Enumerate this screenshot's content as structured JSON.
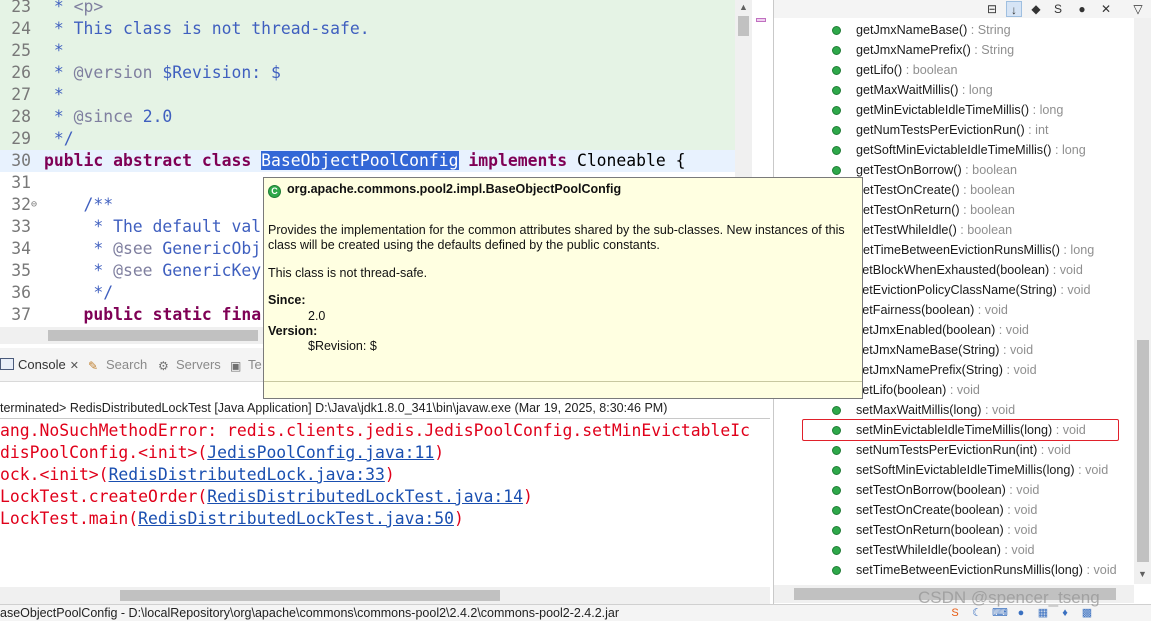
{
  "editor": {
    "lines": [
      {
        "num": "23",
        "tokens": [
          {
            "cls": "c-com",
            "text": " * "
          },
          {
            "cls": "c-tag",
            "text": "<p>"
          }
        ],
        "bg": "comment-bg"
      },
      {
        "num": "24",
        "tokens": [
          {
            "cls": "c-com",
            "text": " * This class is not thread-safe."
          }
        ],
        "bg": "comment-bg"
      },
      {
        "num": "25",
        "tokens": [
          {
            "cls": "c-com",
            "text": " *"
          }
        ],
        "bg": "comment-bg"
      },
      {
        "num": "26",
        "tokens": [
          {
            "cls": "c-com",
            "text": " * "
          },
          {
            "cls": "c-tag",
            "text": "@version"
          },
          {
            "cls": "c-com",
            "text": " $Revision: $"
          }
        ],
        "bg": "comment-bg"
      },
      {
        "num": "27",
        "tokens": [
          {
            "cls": "c-com",
            "text": " *"
          }
        ],
        "bg": "comment-bg"
      },
      {
        "num": "28",
        "tokens": [
          {
            "cls": "c-com",
            "text": " * "
          },
          {
            "cls": "c-tag",
            "text": "@since"
          },
          {
            "cls": "c-com",
            "text": " 2.0"
          }
        ],
        "bg": "comment-bg"
      },
      {
        "num": "29",
        "tokens": [
          {
            "cls": "c-com",
            "text": " */"
          }
        ],
        "bg": "comment-bg"
      },
      {
        "num": "30",
        "tokens": [
          {
            "cls": "c-kw",
            "text": "public"
          },
          {
            "cls": "",
            "text": " "
          },
          {
            "cls": "c-kw",
            "text": "abstract"
          },
          {
            "cls": "",
            "text": " "
          },
          {
            "cls": "c-kw",
            "text": "class"
          },
          {
            "cls": "",
            "text": " "
          },
          {
            "cls": "c-sel",
            "text": "BaseObjectPoolConfig"
          },
          {
            "cls": "",
            "text": " "
          },
          {
            "cls": "c-kw",
            "text": "implements"
          },
          {
            "cls": "",
            "text": " Cloneable {"
          }
        ],
        "bg": "current"
      },
      {
        "num": "31",
        "tokens": [],
        "bg": ""
      },
      {
        "num": "32",
        "fold": "⊖",
        "tokens": [
          {
            "cls": "c-com",
            "text": "    /**"
          }
        ],
        "bg": ""
      },
      {
        "num": "33",
        "tokens": [
          {
            "cls": "c-com",
            "text": "     * The default val"
          }
        ],
        "bg": ""
      },
      {
        "num": "34",
        "tokens": [
          {
            "cls": "c-com",
            "text": "     * "
          },
          {
            "cls": "c-tag",
            "text": "@see"
          },
          {
            "cls": "c-com",
            "text": " GenericObj"
          }
        ],
        "bg": ""
      },
      {
        "num": "35",
        "tokens": [
          {
            "cls": "c-com",
            "text": "     * "
          },
          {
            "cls": "c-tag",
            "text": "@see"
          },
          {
            "cls": "c-com",
            "text": " GenericKey"
          }
        ],
        "bg": ""
      },
      {
        "num": "36",
        "tokens": [
          {
            "cls": "c-com",
            "text": "     */"
          }
        ],
        "bg": ""
      },
      {
        "num": "37",
        "tokens": [
          {
            "cls": "",
            "text": "    "
          },
          {
            "cls": "c-kw",
            "text": "public"
          },
          {
            "cls": "",
            "text": " "
          },
          {
            "cls": "c-kw",
            "text": "static"
          },
          {
            "cls": "",
            "text": " "
          },
          {
            "cls": "c-kw",
            "text": "fina"
          }
        ],
        "bg": ""
      }
    ]
  },
  "console": {
    "tabs": [
      {
        "label": "Console",
        "icon": "console-icon",
        "active": true
      },
      {
        "label": "Search",
        "icon": "search-icon",
        "active": false
      },
      {
        "label": "Servers",
        "icon": "servers-icon",
        "active": false
      },
      {
        "label": "Te",
        "icon": "terminal-icon",
        "active": false
      }
    ],
    "status": "terminated> RedisDistributedLockTest [Java Application] D:\\Java\\jdk1.8.0_341\\bin\\javaw.exe (Mar 19, 2025, 8:30:46 PM)",
    "lines": [
      {
        "text": "ang.NoSuchMethodError: redis.clients.jedis.JedisPoolConfig.setMinEvictableIc",
        "link": "",
        "suffix": ""
      },
      {
        "text": "disPoolConfig.<init>(",
        "link": "JedisPoolConfig.java:11",
        "suffix": ")"
      },
      {
        "text": "ock.<init>(",
        "link": "RedisDistributedLock.java:33",
        "suffix": ")"
      },
      {
        "text": "LockTest.createOrder(",
        "link": "RedisDistributedLockTest.java:14",
        "suffix": ")"
      },
      {
        "text": "LockTest.main(",
        "link": "RedisDistributedLockTest.java:50",
        "suffix": ")"
      }
    ]
  },
  "hover": {
    "title": "org.apache.commons.pool2.impl.BaseObjectPoolConfig",
    "description": "Provides the implementation for the common attributes shared by the sub-classes. New instances of this class will be created using the defaults defined by the public constants.",
    "thread_safety": "This class is not thread-safe.",
    "since_label": "Since:",
    "since_value": "2.0",
    "version_label": "Version:",
    "version_value": "$Revision: $"
  },
  "outline": {
    "toolbar_icons": [
      "collapse-all-icon",
      "sort-icon",
      "hide-fields-icon",
      "hide-static-icon",
      "hide-non-public-icon",
      "hide-local-types-icon",
      "view-menu-icon"
    ],
    "items": [
      {
        "name": "getJmxNameBase()",
        "ret": " : String"
      },
      {
        "name": "getJmxNamePrefix()",
        "ret": " : String"
      },
      {
        "name": "getLifo()",
        "ret": " : boolean"
      },
      {
        "name": "getMaxWaitMillis()",
        "ret": " : long"
      },
      {
        "name": "getMinEvictableIdleTimeMillis()",
        "ret": " : long"
      },
      {
        "name": "getNumTestsPerEvictionRun()",
        "ret": " : int"
      },
      {
        "name": "getSoftMinEvictableIdleTimeMillis()",
        "ret": " : long"
      },
      {
        "name": "getTestOnBorrow()",
        "ret": " : boolean"
      },
      {
        "name": "getTestOnCreate()",
        "ret": " : boolean"
      },
      {
        "name": "getTestOnReturn()",
        "ret": " : boolean"
      },
      {
        "name": "getTestWhileIdle()",
        "ret": " : boolean"
      },
      {
        "name": "getTimeBetweenEvictionRunsMillis()",
        "ret": " : long"
      },
      {
        "name": "setBlockWhenExhausted(boolean)",
        "ret": " : void"
      },
      {
        "name": "setEvictionPolicyClassName(String)",
        "ret": " : void"
      },
      {
        "name": "setFairness(boolean)",
        "ret": " : void"
      },
      {
        "name": "setJmxEnabled(boolean)",
        "ret": " : void"
      },
      {
        "name": "setJmxNameBase(String)",
        "ret": " : void"
      },
      {
        "name": "setJmxNamePrefix(String)",
        "ret": " : void"
      },
      {
        "name": "setLifo(boolean)",
        "ret": " : void"
      },
      {
        "name": "setMaxWaitMillis(long)",
        "ret": " : void"
      },
      {
        "name": "setMinEvictableIdleTimeMillis(long)",
        "ret": " : void",
        "highlighted": true
      },
      {
        "name": "setNumTestsPerEvictionRun(int)",
        "ret": " : void"
      },
      {
        "name": "setSoftMinEvictableIdleTimeMillis(long)",
        "ret": " : void"
      },
      {
        "name": "setTestOnBorrow(boolean)",
        "ret": " : void"
      },
      {
        "name": "setTestOnCreate(boolean)",
        "ret": " : void"
      },
      {
        "name": "setTestOnReturn(boolean)",
        "ret": " : void"
      },
      {
        "name": "setTestWhileIdle(boolean)",
        "ret": " : void"
      },
      {
        "name": "setTimeBetweenEvictionRunsMillis(long)",
        "ret": " : void"
      }
    ]
  },
  "status_bar": {
    "text": "aseObjectPoolConfig - D:\\localRepository\\org\\apache\\commons\\commons-pool2\\2.4.2\\commons-pool2-2.4.2.jar"
  },
  "watermark": "CSDN @spencer_tseng"
}
